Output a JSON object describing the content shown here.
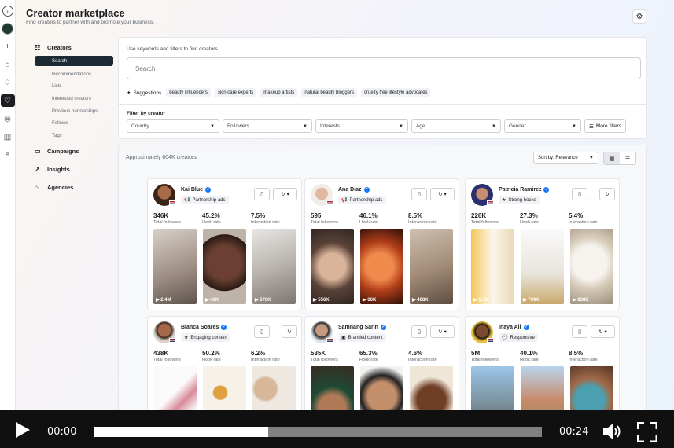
{
  "header": {
    "title": "Creator marketplace",
    "subtitle": "Find creators to partner with and promote your business."
  },
  "sidenav": {
    "creators_label": "Creators",
    "creators_sub": [
      "Search",
      "Recommendations",
      "Lists",
      "Interested creators",
      "Previous partnerships",
      "Follows",
      "Tags"
    ],
    "campaigns_label": "Campaigns",
    "insights_label": "Insights",
    "agencies_label": "Agencies"
  },
  "search": {
    "hint": "Use keywords and filters to find creators",
    "placeholder": "Search",
    "suggestions_label": "Suggestions",
    "suggestions": [
      "beauty influencers",
      "skin care experts",
      "makeup artists",
      "natural beauty bloggers",
      "cruelty free lifestyle advocates"
    ],
    "filter_label": "Filter by creator",
    "filters": [
      "Country",
      "Followers",
      "Interests",
      "Age",
      "Gender"
    ],
    "more_filters": "More filters"
  },
  "results": {
    "count": "Approximately 604K creators",
    "sort": "Sort by: Relevance"
  },
  "stat_labels": {
    "followers": "Total followers",
    "hook": "Hook rate",
    "interaction": "Interaction rate"
  },
  "creators": [
    {
      "name": "Kai Blue",
      "badge": "Partnership ads",
      "badge_icon": "megaphone-icon",
      "followers": "346K",
      "hook": "45.2%",
      "interaction": "7.5%",
      "views": [
        "2.4M",
        "48K",
        "678K"
      ]
    },
    {
      "name": "Ana Diaz",
      "badge": "Partnership ads",
      "badge_icon": "megaphone-icon",
      "followers": "595",
      "hook": "46.1%",
      "interaction": "8.5%",
      "views": [
        "556K",
        "66K",
        "408K"
      ]
    },
    {
      "name": "Patricia Ramirez",
      "badge": "Strong hooks",
      "badge_icon": "star-icon",
      "followers": "226K",
      "hook": "27.3%",
      "interaction": "5.4%",
      "views": [
        "1.1M",
        "709K",
        "838K"
      ]
    },
    {
      "name": "Bianca Soares",
      "badge": "Engaging content",
      "badge_icon": "star-icon",
      "followers": "438K",
      "hook": "50.2%",
      "interaction": "6.2%",
      "views": [
        "",
        "",
        ""
      ]
    },
    {
      "name": "Samnang Sarin",
      "badge": "Branded content",
      "badge_icon": "branded-icon",
      "followers": "535K",
      "hook": "65.3%",
      "interaction": "4.6%",
      "views": [
        "",
        "",
        ""
      ]
    },
    {
      "name": "Inaya Ali",
      "badge": "Responsive",
      "badge_icon": "chat-icon",
      "followers": "5M",
      "hook": "40.1%",
      "interaction": "8.5%",
      "views": [
        "",
        "",
        ""
      ]
    }
  ],
  "video": {
    "current_time": "00:00",
    "duration": "00:24",
    "progress": 0.39
  },
  "colors": {
    "accent": "#1877f2",
    "nav_active": "#1c2a33",
    "player_bg": "#101010"
  }
}
